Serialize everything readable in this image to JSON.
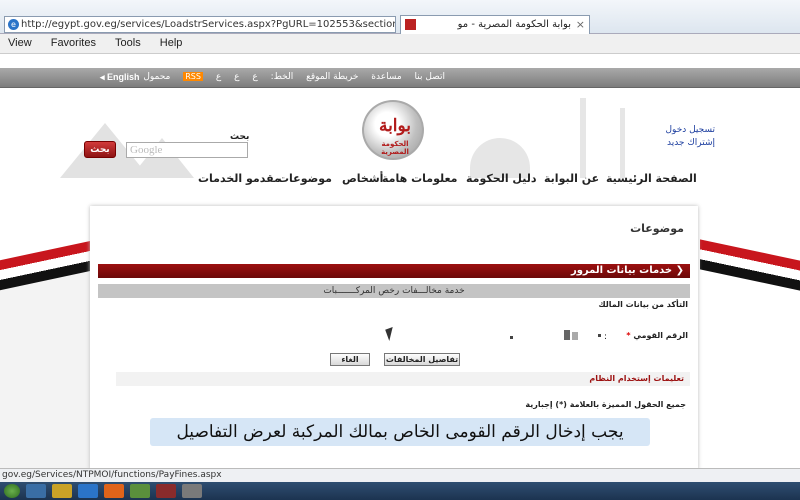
{
  "browser": {
    "url": "http://egypt.gov.eg/services/LoadstrServices.aspx?PgURL=102553&section=subjects",
    "tab_title": "بوابة الحكومة المصرية - مو",
    "menu": [
      "View",
      "Favorites",
      "Tools",
      "Help"
    ],
    "status_url": "gov.eg/Services/NTPMOI/functions/PayFines.aspx"
  },
  "topbar": {
    "english": "◂ English",
    "links": [
      "اتصل بنا",
      "مساعدة",
      "خريطة الموقع",
      "الخط:",
      "ع",
      "ع",
      "ع",
      "RSS",
      "محمول"
    ]
  },
  "header": {
    "search_label": "بحث",
    "search_placeholder": "Google",
    "search_button": "بحث",
    "logo_text": "بوابة",
    "logo_sub": "الحكومة المصرية",
    "login": "تسجيل دخول",
    "register": "إشتراك جديد"
  },
  "nav": [
    "الصفحة الرئيسية",
    "عن البوابة",
    "دليل الحكومة",
    "معلومات هامة",
    "أشخاص",
    "موضوعات",
    "مقدمو الخدمات"
  ],
  "panel": {
    "title": "موضوعات",
    "section_bar": "خدمات بيانات المرور",
    "service_title": "خدمة مخالـــفات رخص المركـــــــبات",
    "verify": "التأكد من بيانات المالك",
    "id_label": "الرقم القومي",
    "id_star": "*",
    "colon": ":",
    "details_button": "تفاصيل المخالفات",
    "cancel_button": "الغاء",
    "notes": "تعليمات إستخدام النظام",
    "required": "جميع الحقول المميزة بالعلامة (*) إجبارية"
  },
  "caption": "يجب إدخال الرقم القومى الخاص بمالك المركبة لعرض التفاصيل",
  "colors": {
    "brand_red": "#9c1010",
    "link_blue": "#1a3c9e"
  }
}
